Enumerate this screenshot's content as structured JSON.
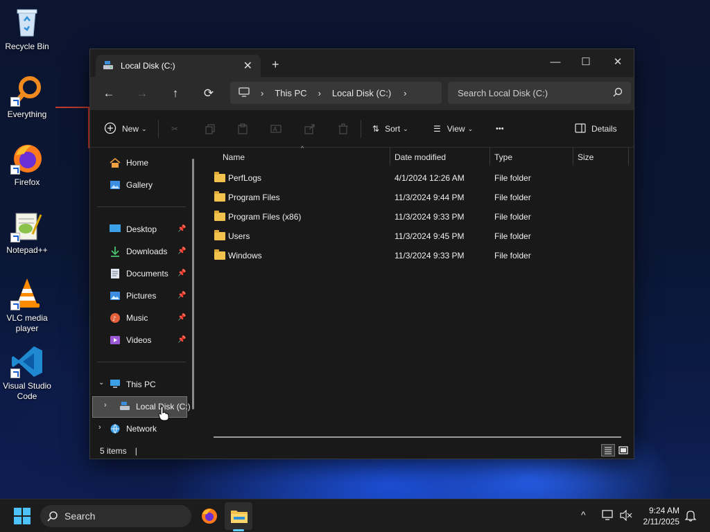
{
  "desktop": {
    "icons": [
      {
        "label": "Recycle Bin"
      },
      {
        "label": "Everything"
      },
      {
        "label": "Firefox"
      },
      {
        "label": "Notepad++"
      },
      {
        "label": "VLC media player"
      },
      {
        "label": "Visual Studio Code"
      }
    ]
  },
  "window": {
    "tab_title": "Local Disk (C:)",
    "tab_close": "✕",
    "new_tab": "+",
    "controls": {
      "minimize": "—",
      "maximize": "☐",
      "close": "✕"
    },
    "address": {
      "crumbs": [
        "This PC",
        "Local Disk (C:)"
      ],
      "separator": "›"
    },
    "search_placeholder": "Search Local Disk (C:)",
    "toolbar": {
      "new_label": "New",
      "sort_label": "Sort",
      "view_label": "View",
      "more_label": "•••",
      "details_label": "Details"
    },
    "sidebar": {
      "quick": [
        {
          "label": "Home"
        },
        {
          "label": "Gallery"
        }
      ],
      "pinned": [
        {
          "label": "Desktop"
        },
        {
          "label": "Downloads"
        },
        {
          "label": "Documents"
        },
        {
          "label": "Pictures"
        },
        {
          "label": "Music"
        },
        {
          "label": "Videos"
        }
      ],
      "tree": [
        {
          "label": "This PC"
        },
        {
          "label": "Local Disk (C:)"
        },
        {
          "label": "Network"
        }
      ]
    },
    "columns": {
      "name": "Name",
      "date": "Date modified",
      "type": "Type",
      "size": "Size"
    },
    "files": [
      {
        "name": "PerfLogs",
        "date": "4/1/2024 12:26 AM",
        "type": "File folder"
      },
      {
        "name": "Program Files",
        "date": "11/3/2024 9:44 PM",
        "type": "File folder"
      },
      {
        "name": "Program Files (x86)",
        "date": "11/3/2024 9:33 PM",
        "type": "File folder"
      },
      {
        "name": "Users",
        "date": "11/3/2024 9:45 PM",
        "type": "File folder"
      },
      {
        "name": "Windows",
        "date": "11/3/2024 9:33 PM",
        "type": "File folder"
      }
    ],
    "status": {
      "items": "5 items",
      "divider": "|"
    }
  },
  "taskbar": {
    "search_label": "Search",
    "time": "9:24 AM",
    "date": "2/11/2025"
  },
  "colors": {
    "folder": "#f2c14e",
    "accent": "#60cdff",
    "window_bg": "#191919"
  }
}
